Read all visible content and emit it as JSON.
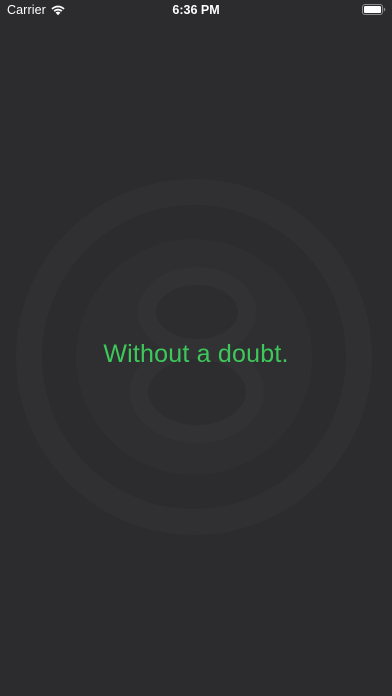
{
  "status_bar": {
    "carrier": "Carrier",
    "time": "6:36 PM",
    "wifi_icon": "wifi-icon",
    "battery_icon": "battery-icon"
  },
  "magic_ball": {
    "answer": "Without a doubt.",
    "answer_color": "#3cc85a",
    "background_color": "#2c2c2e",
    "watermark": "eight-ball-icon"
  }
}
